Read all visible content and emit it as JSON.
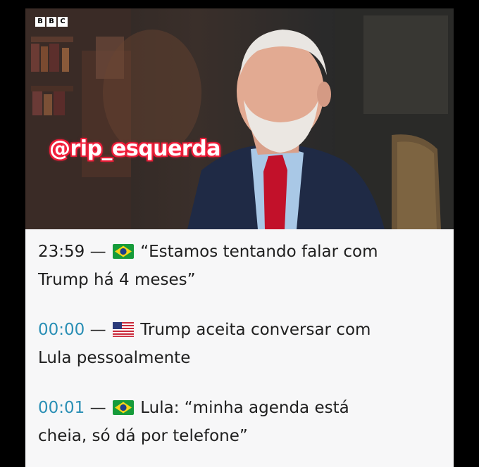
{
  "video": {
    "logo_letters": [
      "B",
      "B",
      "C"
    ],
    "watermark": "@rip_esquerda"
  },
  "entries": [
    {
      "time": "23:59",
      "separator": "—",
      "flag": "brazil-flag",
      "text_line1": "“Estamos tentando falar com",
      "text_line2": "Trump há 4 meses”",
      "time_color": "#1f1f1f"
    },
    {
      "time": "00:00",
      "separator": "—",
      "flag": "usa-flag",
      "text_line1": "Trump aceita conversar com",
      "text_line2": "Lula pessoalmente",
      "time_color": "#2a8fb5"
    },
    {
      "time": "00:01",
      "separator": "—",
      "flag": "brazil-flag",
      "text_line1": "Lula: “minha agenda está",
      "text_line2": "cheia, só dá por telefone”",
      "time_color": "#2a8fb5"
    }
  ]
}
